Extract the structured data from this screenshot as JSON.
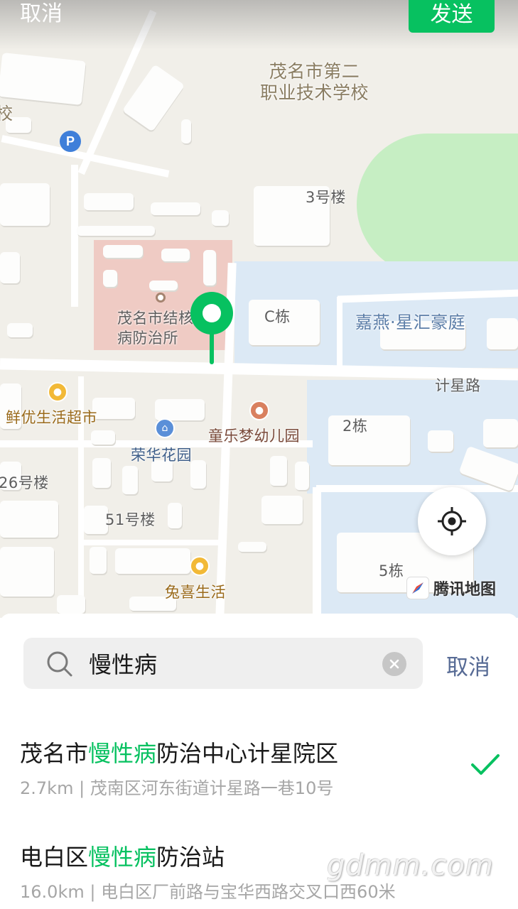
{
  "header": {
    "cancel_label": "取消",
    "send_label": "发送"
  },
  "map": {
    "labels": {
      "school": "茂名市第二\n职业技术学校",
      "school_cut": "校",
      "building3": "3号楼",
      "clinic": "茂名市结核\n病防治所",
      "c_dong": "C栋",
      "jiayan": "嘉燕·星汇豪庭",
      "jixing_road": "计星路",
      "xianyou": "鲜优生活超市",
      "tongle": "童乐梦幼儿园",
      "dong2": "2栋",
      "ronghua": "荣华花园",
      "lou26": "26号楼",
      "lou51": "51号楼",
      "dong5": "5栋",
      "tuxi": "兔喜生活"
    },
    "logo_text": "腾讯地图",
    "parking_symbol": "P"
  },
  "search": {
    "query": "慢性病",
    "cancel_label": "取消"
  },
  "results": [
    {
      "title_pre": "茂名市",
      "title_hl": "慢性病",
      "title_post": "防治中心计星院区",
      "distance": "2.7km",
      "separator": " | ",
      "address": "茂南区河东街道计星路一巷10号",
      "selected": true
    },
    {
      "title_pre": "电白区",
      "title_hl": "慢性病",
      "title_post": "防治站",
      "distance": "16.0km",
      "separator": " | ",
      "address": "电白区厂前路与宝华西路交叉口西60米",
      "selected": false
    }
  ],
  "watermark": "gdmm.com",
  "colors": {
    "accent_green": "#07c160",
    "link_blue": "#576b95"
  }
}
